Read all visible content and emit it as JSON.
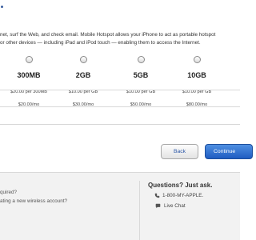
{
  "intro": {
    "line1": "net, surf the Web, and check email. Mobile Hotspot allows your iPhone to act as portable hotspot",
    "line2": "or other devices — including iPad and iPod touch — enabling them to access the Internet."
  },
  "plans": [
    {
      "name": "300MB",
      "rate": "$20.00 per 300MB",
      "monthly": "$20.00/mo"
    },
    {
      "name": "2GB",
      "rate": "$10.00 per GB",
      "monthly": "$30.00/mo"
    },
    {
      "name": "5GB",
      "rate": "$10.00 per GB",
      "monthly": "$50.00/mo"
    },
    {
      "name": "10GB",
      "rate": "$10.00 per GB",
      "monthly": "$80.00/mo"
    }
  ],
  "buttons": {
    "back": "Back",
    "continue": "Continue"
  },
  "footer": {
    "left_line1": "quired?",
    "left_line2": "ating a new wireless account?",
    "help_title": "Questions? Just ask.",
    "phone": "1-800-MY-APPLE.",
    "chat": "Live Chat"
  },
  "icons": {
    "phone": "phone-icon",
    "chat": "chat-bubble-icon"
  },
  "colors": {
    "accent": "#1f5cc1",
    "link": "#2a55a5",
    "footer_bg": "#f2f2f2"
  }
}
